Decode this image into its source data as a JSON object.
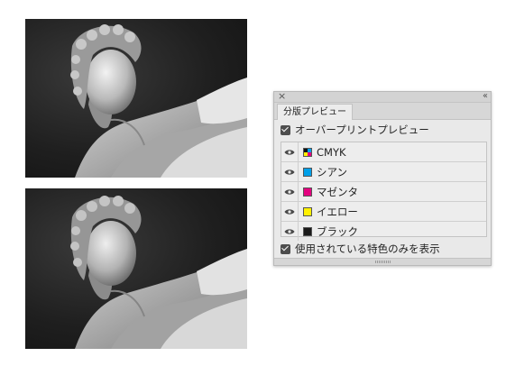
{
  "panel": {
    "tab_label": "分版プレビュー",
    "overprint_label": "オーバープリントプレビュー",
    "overprint_checked": true,
    "spot_only_label": "使用されている特色のみを表示",
    "spot_only_checked": true,
    "close_icon": "close-icon",
    "collapse_icon": "double-chevron-left-icon",
    "plates": [
      {
        "label": "CMYK",
        "color": "cmyk",
        "visible": true
      },
      {
        "label": "シアン",
        "color": "#00a0e9",
        "visible": true
      },
      {
        "label": "マゼンタ",
        "color": "#e4007f",
        "visible": true
      },
      {
        "label": "イエロー",
        "color": "#fff100",
        "visible": true
      },
      {
        "label": "ブラック",
        "color": "#1a1a1a",
        "visible": true
      }
    ]
  }
}
